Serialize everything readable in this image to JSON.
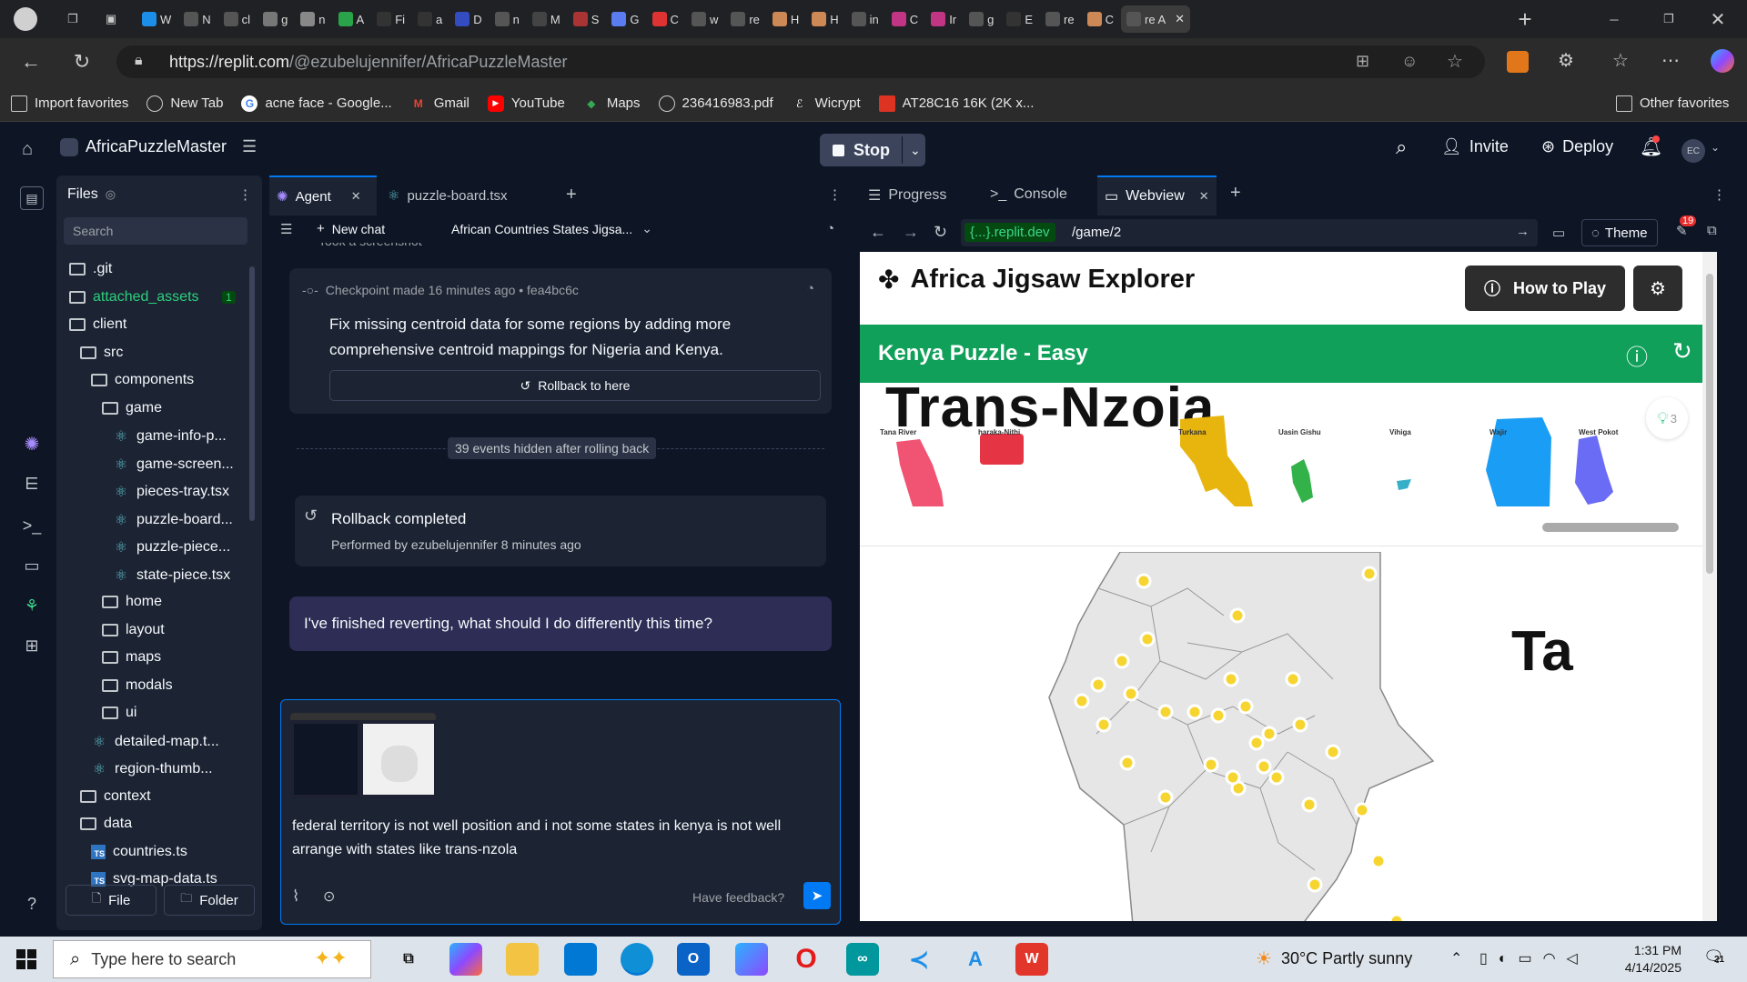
{
  "browser": {
    "url_domain": "https://replit.com",
    "url_path": "/@ezubelujennifer/AfricaPuzzleMaster",
    "tabs": [
      "W",
      "N",
      "cl",
      "g",
      "n",
      "A",
      "Fi",
      "a",
      "D",
      "n",
      "M",
      "S",
      "G",
      "C",
      "w",
      "re",
      "H",
      "H",
      "in",
      "C",
      "Ir",
      "g",
      "E",
      "re",
      "C",
      "re A"
    ],
    "bookmarks": [
      {
        "label": "Import favorites"
      },
      {
        "label": "New Tab"
      },
      {
        "label": "acne face - Google..."
      },
      {
        "label": "Gmail"
      },
      {
        "label": "YouTube"
      },
      {
        "label": "Maps"
      },
      {
        "label": "236416983.pdf"
      },
      {
        "label": "Wicrypt"
      },
      {
        "label": "AT28C16 16K (2K x..."
      }
    ],
    "other_favorites": "Other favorites"
  },
  "replit": {
    "project_name": "AfricaPuzzleMaster",
    "stop_label": "Stop",
    "invite_label": "Invite",
    "deploy_label": "Deploy",
    "avatar_initials": "EC"
  },
  "files": {
    "title": "Files",
    "search_placeholder": "Search",
    "badge": "1",
    "items": [
      {
        "label": ".git"
      },
      {
        "label": "attached_assets"
      },
      {
        "label": "client"
      },
      {
        "label": "src"
      },
      {
        "label": "components"
      },
      {
        "label": "game"
      },
      {
        "label": "game-info-p..."
      },
      {
        "label": "game-screen..."
      },
      {
        "label": "pieces-tray.tsx"
      },
      {
        "label": "puzzle-board..."
      },
      {
        "label": "puzzle-piece..."
      },
      {
        "label": "state-piece.tsx"
      },
      {
        "label": "home"
      },
      {
        "label": "layout"
      },
      {
        "label": "maps"
      },
      {
        "label": "modals"
      },
      {
        "label": "ui"
      },
      {
        "label": "detailed-map.t..."
      },
      {
        "label": "region-thumb..."
      },
      {
        "label": "context"
      },
      {
        "label": "data"
      },
      {
        "label": "countries.ts"
      },
      {
        "label": "svg-map-data.ts"
      }
    ],
    "file_btn": "File",
    "folder_btn": "Folder"
  },
  "agent": {
    "tab_agent": "Agent",
    "tab_file": "puzzle-board.tsx",
    "new_chat": "New chat",
    "chat_title": "African Countries States Jigsa...",
    "cut_text": "Took a screenshot",
    "checkpoint_meta": "Checkpoint made 16 minutes ago • fea4bc6c",
    "checkpoint_msg": "Fix missing centroid data for some regions by adding more comprehensive centroid mappings for Nigeria and Kenya.",
    "rollback_btn": "Rollback to here",
    "hidden_events": "39 events hidden after rolling back",
    "rollback_title": "Rollback completed",
    "rollback_by": "Performed by ezubelujennifer 8 minutes ago",
    "prompt_msg": "I've finished reverting, what should I do differently this time?",
    "input_text": "federal territory is not well position and i not some states in kenya is not well arrange with states like trans-nzola",
    "feedback": "Have feedback?"
  },
  "webview": {
    "tab_progress": "Progress",
    "tab_console": "Console",
    "tab_webview": "Webview",
    "domain_chip": "{...}.replit.dev",
    "path": "/game/2",
    "theme": "Theme",
    "notif_count": "19"
  },
  "game": {
    "title": "Africa Jigsaw Explorer",
    "how_to_play": "How to Play",
    "puzzle_title": "Kenya Puzzle - Easy",
    "big_label": "Trans-Nzoia",
    "right_label": "Ta",
    "hint_count": "3",
    "pieces": [
      "Tana River",
      "haraka-Nithi",
      "Turkana",
      "Uasin Gishu",
      "Vihiga",
      "Wajir",
      "West Pokot"
    ],
    "colors": {
      "header_green": "#10a05a",
      "dot": "#f7d531"
    }
  },
  "taskbar": {
    "search_placeholder": "Type here to search",
    "weather": "30°C  Partly sunny",
    "time": "1:31 PM",
    "date": "4/14/2025",
    "notif": "21"
  }
}
